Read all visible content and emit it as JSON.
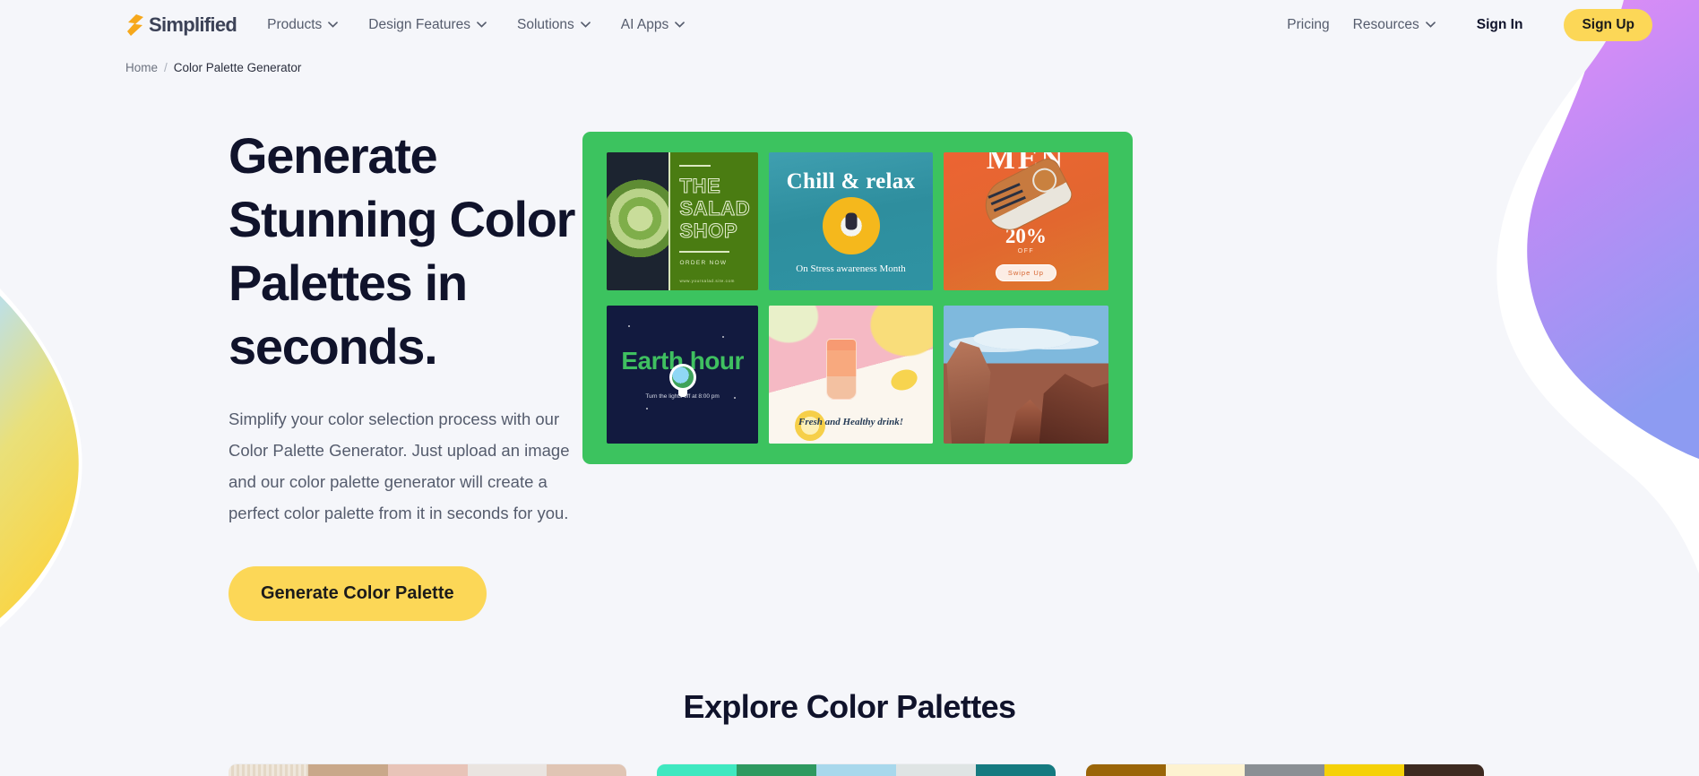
{
  "page": {
    "background_color": "#f5f6fa",
    "accent_yellow": "#fcd757",
    "brand_green": "#3cc35f"
  },
  "header": {
    "logo": {
      "text": "Simplified",
      "icon": "simplified-bolt-logo"
    },
    "nav_left": [
      {
        "label": "Products",
        "has_dropdown": true
      },
      {
        "label": "Design Features",
        "has_dropdown": true
      },
      {
        "label": "Solutions",
        "has_dropdown": true
      },
      {
        "label": "AI Apps",
        "has_dropdown": true
      }
    ],
    "nav_right": [
      {
        "label": "Pricing",
        "has_dropdown": false
      },
      {
        "label": "Resources",
        "has_dropdown": true
      }
    ],
    "sign_in_label": "Sign In",
    "sign_up_label": "Sign Up"
  },
  "breadcrumb": {
    "home": "Home",
    "separator": "/",
    "current": "Color Palette Generator"
  },
  "hero": {
    "title": "Generate Stunning Color Palettes in seconds.",
    "subtitle": "Simplify your color selection process with our Color Palette Generator. Just upload an image and our color palette generator will create a perfect color palette from it in seconds for you.",
    "cta_label": "Generate Color Palette",
    "collage": {
      "frame_color": "#3cc35f",
      "tiles": [
        {
          "name": "salad-shop-poster",
          "headline": "THE SALAD SHOP",
          "cta": "ORDER NOW",
          "url": "www.yoursalad.site.com"
        },
        {
          "name": "chill-relax-poster",
          "headline": "Chill & relax",
          "caption": "On Stress awareness Month"
        },
        {
          "name": "mens-shoe-sale-poster",
          "headline": "MEN",
          "discount": "20%",
          "discount_sub": "OFF",
          "cta": "Swipe Up"
        },
        {
          "name": "earth-hour-poster",
          "headline": "Earth hour",
          "caption": "Turn the lights off at 8:00 pm"
        },
        {
          "name": "fresh-drink-poster",
          "caption": "Fresh and Healthy drink!"
        },
        {
          "name": "canyon-landscape-photo"
        }
      ]
    }
  },
  "explore": {
    "title": "Explore Color Palettes",
    "palettes": [
      {
        "name": "palette-neutral-warm",
        "colors": [
          "striped",
          "#c9a88a",
          "#e8c4b8",
          "#eae4e0",
          "#e0c5b4"
        ]
      },
      {
        "name": "palette-teal-green",
        "colors": [
          "#3fe8c0",
          "#2e9960",
          "#a8d8ec",
          "#dfe4e4",
          "#157a80"
        ]
      },
      {
        "name": "palette-gold-brown",
        "colors": [
          "#9a6508",
          "#fdf2d0",
          "#8a8f94",
          "#f5d108",
          "#3d2a20"
        ]
      }
    ]
  }
}
